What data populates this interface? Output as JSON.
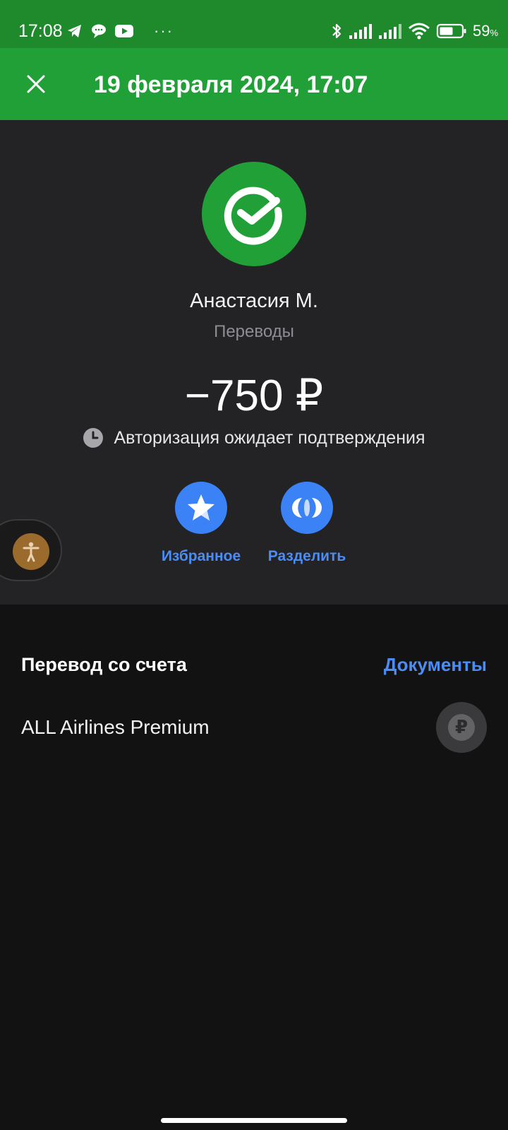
{
  "status_bar": {
    "time": "17:08",
    "dots": "···",
    "battery_percent": "59",
    "battery_unit": "%"
  },
  "header": {
    "title": "19 февраля 2024, 17:07"
  },
  "transaction": {
    "recipient": "Анастасия М.",
    "category": "Переводы",
    "amount": "−750 ₽",
    "status": "Авторизация ожидает подтверждения"
  },
  "actions": {
    "favorite_label": "Избранное",
    "split_label": "Разделить"
  },
  "account": {
    "heading": "Перевод со счета",
    "documents_label": "Документы",
    "name": "ALL Airlines Premium",
    "currency_symbol": "₽"
  },
  "colors": {
    "status_bar": "#1f8a2c",
    "header": "#21a038",
    "accent_blue": "#3b82f6",
    "link_blue": "#4b8df5",
    "detail_background": "#232325",
    "page_background": "#121212"
  },
  "icons": {
    "close": "close-icon",
    "merchant": "sber-logo-icon",
    "pending": "clock-icon",
    "favorite": "star-icon",
    "split": "split-icon",
    "accessibility": "accessibility-icon",
    "account": "ruble-icon"
  }
}
